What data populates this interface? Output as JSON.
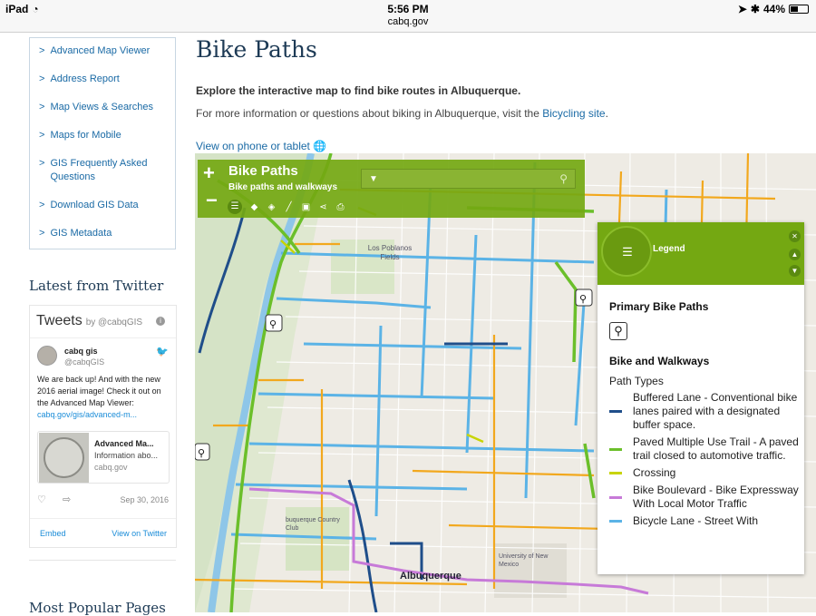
{
  "status_bar": {
    "device": "iPad",
    "time": "5:56 PM",
    "url": "cabq.gov",
    "battery": "44%"
  },
  "sidebar": {
    "items": [
      {
        "label": "Advanced Map Viewer"
      },
      {
        "label": "Address Report"
      },
      {
        "label": "Map Views & Searches"
      },
      {
        "label": "Maps for Mobile"
      },
      {
        "label": "GIS Frequently Asked Questions"
      },
      {
        "label": "Download GIS Data"
      },
      {
        "label": "GIS Metadata"
      }
    ],
    "chevron": ">"
  },
  "twitter": {
    "heading": "Latest from Twitter",
    "title": "Tweets",
    "by": "by @cabqGIS",
    "name": "cabq gis",
    "handle": "@cabqGIS",
    "text": "We are back up! And with the new 2016 aerial image!  Check it out on the Advanced Map Viewer:",
    "link": "cabq.gov/gis/advanced-m...",
    "preview_title": "Advanced Ma...",
    "preview_desc": "Information abo...",
    "preview_site": "cabq.gov",
    "date": "Sep 30, 2016",
    "embed": "Embed",
    "view": "View on Twitter"
  },
  "popular_heading": "Most Popular Pages",
  "main": {
    "title": "Bike Paths",
    "intro": "Explore the interactive map to find bike routes in Albuquerque.",
    "more_info_prefix": "For more information or questions about biking in Albuquerque, visit the ",
    "more_info_link": "Bicycling site",
    "more_info_suffix": ".",
    "phone_link": "View on phone or tablet"
  },
  "map": {
    "title": "Bike Paths",
    "subtitle": "Bike paths and walkways",
    "zoom_in": "+",
    "zoom_out": "−",
    "map_labels": {
      "albuquerque": "Albuquerque",
      "los_poblanos": "Los Poblanos Fields",
      "university": "University of New Mexico",
      "country_club": "buquerque Country Club"
    }
  },
  "legend": {
    "title": "Legend",
    "primary_title": "Primary Bike Paths",
    "walk_title": "Bike and Walkways",
    "path_types": "Path Types",
    "items": [
      {
        "label": "Buffered Lane - Conventional bike lanes paired with a designated buffer space.",
        "color": "#1f4e8a"
      },
      {
        "label": "Paved Multiple Use Trail - A paved trail closed to automotive traffic.",
        "color": "#6bbf2a"
      },
      {
        "label": "Crossing",
        "color": "#c8d400"
      },
      {
        "label": "Bike Boulevard - Bike Expressway With Local Motor Traffic",
        "color": "#c77ad8"
      },
      {
        "label": "Bicycle Lane - Street With",
        "color": "#5bb3e6"
      }
    ]
  },
  "colors": {
    "accent": "#74a812",
    "link": "#1a6aa5",
    "heading": "#1d3a55"
  }
}
